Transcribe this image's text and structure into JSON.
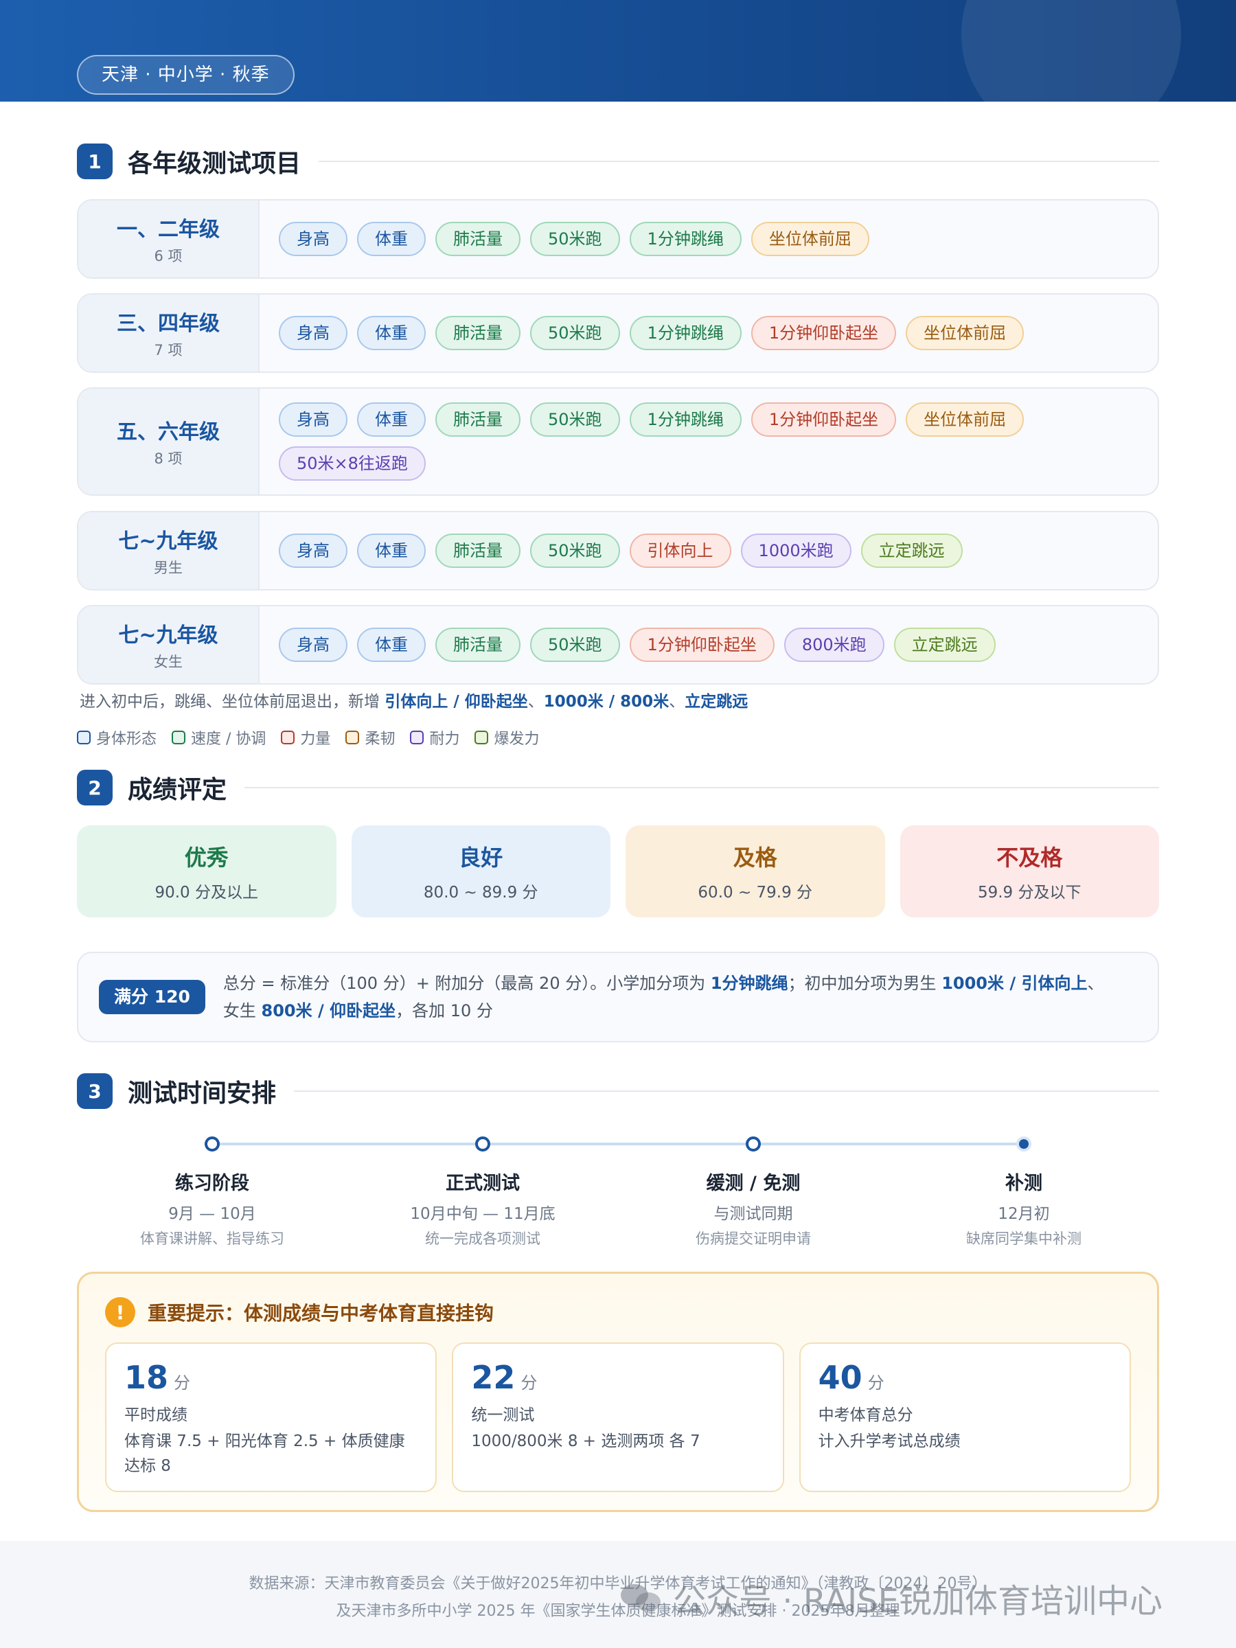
{
  "header": {
    "tag": "天津 · 中小学 · 秋季"
  },
  "section1": {
    "num": "1",
    "title": "各年级测试项目",
    "rows": [
      {
        "name": "一、二年级",
        "sub": "6 项",
        "items": [
          {
            "label": "身高",
            "color": "blue"
          },
          {
            "label": "体重",
            "color": "blue"
          },
          {
            "label": "肺活量",
            "color": "green"
          },
          {
            "label": "50米跑",
            "color": "green"
          },
          {
            "label": "1分钟跳绳",
            "color": "green"
          },
          {
            "label": "坐位体前屈",
            "color": "orange"
          }
        ]
      },
      {
        "name": "三、四年级",
        "sub": "7 项",
        "items": [
          {
            "label": "身高",
            "color": "blue"
          },
          {
            "label": "体重",
            "color": "blue"
          },
          {
            "label": "肺活量",
            "color": "green"
          },
          {
            "label": "50米跑",
            "color": "green"
          },
          {
            "label": "1分钟跳绳",
            "color": "green"
          },
          {
            "label": "1分钟仰卧起坐",
            "color": "red"
          },
          {
            "label": "坐位体前屈",
            "color": "orange"
          }
        ]
      },
      {
        "name": "五、六年级",
        "sub": "8 项",
        "items": [
          {
            "label": "身高",
            "color": "blue"
          },
          {
            "label": "体重",
            "color": "blue"
          },
          {
            "label": "肺活量",
            "color": "green"
          },
          {
            "label": "50米跑",
            "color": "green"
          },
          {
            "label": "1分钟跳绳",
            "color": "green"
          },
          {
            "label": "1分钟仰卧起坐",
            "color": "red"
          },
          {
            "label": "坐位体前屈",
            "color": "orange"
          },
          {
            "label": "50米×8往返跑",
            "color": "purple"
          }
        ]
      },
      {
        "name": "七~九年级",
        "sub": "男生",
        "items": [
          {
            "label": "身高",
            "color": "blue"
          },
          {
            "label": "体重",
            "color": "blue"
          },
          {
            "label": "肺活量",
            "color": "green"
          },
          {
            "label": "50米跑",
            "color": "green"
          },
          {
            "label": "引体向上",
            "color": "red"
          },
          {
            "label": "1000米跑",
            "color": "purple"
          },
          {
            "label": "立定跳远",
            "color": "lime"
          }
        ]
      },
      {
        "name": "七~九年级",
        "sub": "女生",
        "items": [
          {
            "label": "身高",
            "color": "blue"
          },
          {
            "label": "体重",
            "color": "blue"
          },
          {
            "label": "肺活量",
            "color": "green"
          },
          {
            "label": "50米跑",
            "color": "green"
          },
          {
            "label": "1分钟仰卧起坐",
            "color": "red"
          },
          {
            "label": "800米跑",
            "color": "purple"
          },
          {
            "label": "立定跳远",
            "color": "lime"
          }
        ]
      }
    ],
    "note": {
      "prefix": "进入初中后，跳绳、坐位体前屈退出，新增 ",
      "b1": "引体向上 / 仰卧起坐",
      "sep1": "、",
      "b2": "1000米 / 800米",
      "sep2": "、",
      "b3": "立定跳远"
    },
    "legend": [
      {
        "label": "身体形态",
        "color": "blue"
      },
      {
        "label": "速度 / 协调",
        "color": "green"
      },
      {
        "label": "力量",
        "color": "red"
      },
      {
        "label": "柔韧",
        "color": "orange"
      },
      {
        "label": "耐力",
        "color": "purple"
      },
      {
        "label": "爆发力",
        "color": "lime"
      }
    ]
  },
  "section2": {
    "num": "2",
    "title": "成绩评定",
    "grades": [
      {
        "title": "优秀",
        "range": "90.0 分及以上",
        "bg": "#e4f5ec",
        "fg": "#1d7a4a"
      },
      {
        "title": "良好",
        "range": "80.0 ~ 89.9 分",
        "bg": "#e6f0fb",
        "fg": "#1b56a0"
      },
      {
        "title": "及格",
        "range": "60.0 ~ 79.9 分",
        "bg": "#fbeedb",
        "fg": "#9a5c12"
      },
      {
        "title": "不及格",
        "range": "59.9 分及以下",
        "bg": "#fce9e8",
        "fg": "#b02a2a"
      }
    ],
    "score": {
      "badge": "满分 120",
      "t1": "总分 = 标准分（100 分）+ 附加分（最高 20 分）。小学加分项为 ",
      "b1": "1分钟跳绳",
      "t2": "；初中加分项为男生 ",
      "b2": "1000米 / 引体向上",
      "t3": "、",
      "t4": "女生 ",
      "b3": "800米 / 仰卧起坐",
      "t5": "，各加 10 分"
    }
  },
  "section3": {
    "num": "3",
    "title": "测试时间安排",
    "steps": [
      {
        "title": "练习阶段",
        "date": "9月 — 10月",
        "desc": "体育课讲解、指导练习"
      },
      {
        "title": "正式测试",
        "date": "10月中旬 — 11月底",
        "desc": "统一完成各项测试"
      },
      {
        "title": "缓测 / 免测",
        "date": "与测试同期",
        "desc": "伤病提交证明申请"
      },
      {
        "title": "补测",
        "date": "12月初",
        "desc": "缺席同学集中补测"
      }
    ]
  },
  "warning": {
    "icon": "!",
    "title": "重要提示：体测成绩与中考体育直接挂钩",
    "cards": [
      {
        "num": "18",
        "unit": "分",
        "label": "平时成绩",
        "desc": "体育课 7.5 + 阳光体育 2.5 + 体质健康达标 8"
      },
      {
        "num": "22",
        "unit": "分",
        "label": "统一测试",
        "desc": "1000/800米 8 + 选测两项 各 7"
      },
      {
        "num": "40",
        "unit": "分",
        "label": "中考体育总分",
        "desc": "计入升学考试总成绩"
      }
    ]
  },
  "footer": {
    "line1": "数据来源：天津市教育委员会《关于做好2025年初中毕业升学体育考试工作的通知》（津教政〔2024〕20号）",
    "line2": "及天津市多所中小学 2025 年《国家学生体质健康标准》测试安排 · 2025年8月整理",
    "watermark": "公众号 · RAISE锐加体育培训中心"
  }
}
